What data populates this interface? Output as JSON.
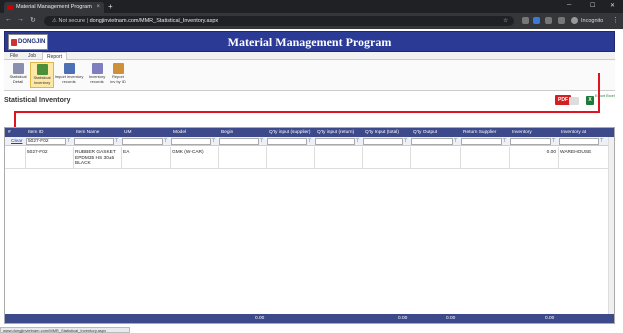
{
  "browser": {
    "tab_title": "Material Management Program",
    "tab_close": "×",
    "new_tab": "+",
    "security_label": "Not secure",
    "separator": "|",
    "url": "dongjinvietnam.com/MMR_Statistical_Inventory.aspx",
    "incognito_label": "Incognito",
    "status_url": "www.dongjinvietnam.com/MMR_Statistical_Inventory.aspx"
  },
  "app": {
    "title": "Material Management Program",
    "logo_text": "DONGJIN"
  },
  "menu": [
    "File",
    "Job",
    "Report"
  ],
  "ribbon": [
    {
      "label": "Statistical Detail",
      "icon": "report-icon",
      "color": "#8a8fb0"
    },
    {
      "label": "Statistical Inventory",
      "icon": "inventory-icon",
      "color": "#4c8f3a"
    },
    {
      "label": "Import inventory records",
      "icon": "import-icon",
      "color": "#4d6fb3"
    },
    {
      "label": "Inventory records",
      "icon": "records-icon",
      "color": "#7f7fbf"
    },
    {
      "label": "Report inv by ID",
      "icon": "report-id-icon",
      "color": "#d0903a"
    }
  ],
  "section": {
    "title": "Statistical Inventory",
    "pdf_label": "PDF",
    "excel_label": "X",
    "excel_caption": "Export Excel"
  },
  "grid": {
    "columns": [
      "#",
      "Item ID",
      "Item Name",
      "UM",
      "Model",
      "Begin",
      "Q'ty input (supplier)",
      "Q'ty input (return)",
      "Q'ty Input (total)",
      "Q'ty Output",
      "Return Supplier",
      "Inventory",
      "Inventory at"
    ],
    "clear_label": "Clear",
    "filter_item_id": "5027-F02",
    "rows": [
      {
        "item_id": "5027-F02",
        "item_name": "RUBBER GASKET EPDM35 HS 30±5 BLACK",
        "um": "EA",
        "model": "GMK (W-CAR)",
        "inventory": "0.00",
        "inventory_at": "WAREHOUSE"
      }
    ],
    "totals": {
      "begin": "0.00",
      "qty_input_total": "0.00",
      "qty_output": "0.00",
      "inventory": "0.00"
    }
  }
}
